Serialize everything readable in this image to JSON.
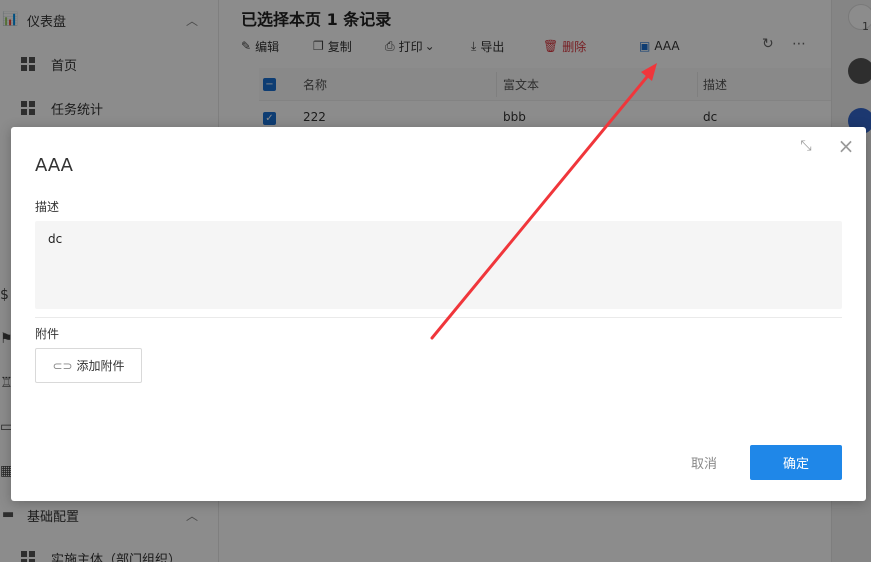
{
  "sidebar": {
    "group_dashboard": "仪表盘",
    "items": [
      {
        "label": "首页"
      },
      {
        "label": "任务统计"
      }
    ],
    "group_base": "基础配置",
    "item_entity": "实施主体（部门组织）"
  },
  "main": {
    "title": "已选择本页 1 条记录",
    "toolbar": {
      "edit": "编辑",
      "copy": "复制",
      "print": "打印",
      "export": "导出",
      "delete": "删除",
      "custom": "AAA"
    },
    "table": {
      "headers": [
        "名称",
        "富文本",
        "描述"
      ],
      "rows": [
        {
          "name": "222",
          "richtext": "bbb",
          "desc": "dc"
        }
      ]
    }
  },
  "rightbar": {
    "badge": "1"
  },
  "dialog": {
    "title": "AAA",
    "desc_label": "描述",
    "desc_value": "dc",
    "attach_label": "附件",
    "attach_button": "添加附件",
    "cancel": "取消",
    "ok": "确定"
  },
  "colors": {
    "primary": "#1f87e8",
    "danger": "#d9363e",
    "annotation_arrow": "#f0363b"
  }
}
